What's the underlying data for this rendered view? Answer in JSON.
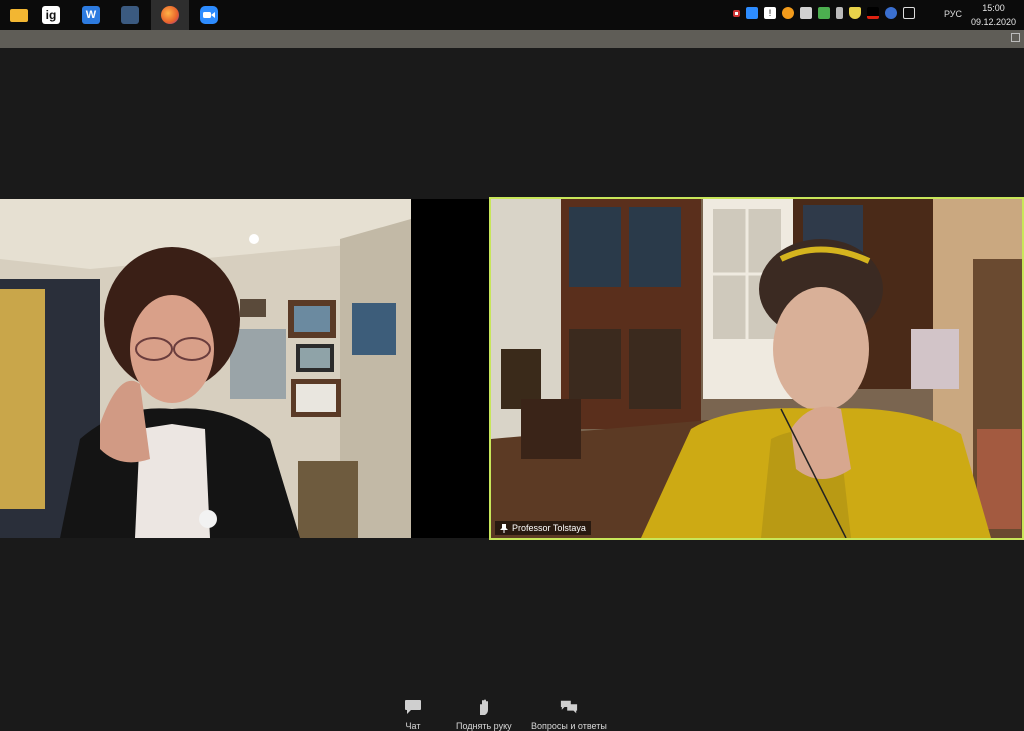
{
  "taskbar": {
    "apps": [
      {
        "name": "file-explorer-icon",
        "glyph": "",
        "color": "#f2b632"
      },
      {
        "name": "ig-app-icon",
        "glyph": "ig",
        "color": "#ffffff"
      },
      {
        "name": "wps-app-icon",
        "glyph": "W",
        "color": "#2d7be0"
      },
      {
        "name": "window-app-icon",
        "glyph": "",
        "color": "#3b5a80"
      },
      {
        "name": "firefox-icon",
        "glyph": "",
        "color": "#e8622b"
      },
      {
        "name": "zoom-icon",
        "glyph": "",
        "color": "#2d8cff"
      }
    ],
    "language": "РУС",
    "time": "15:00",
    "date": "09.12.2020"
  },
  "participants": {
    "speaker_name": "Professor Tolstaya"
  },
  "controls": {
    "chat_label": "Чат",
    "raise_hand_label": "Поднять руку",
    "qa_label": "Вопросы и ответы"
  }
}
